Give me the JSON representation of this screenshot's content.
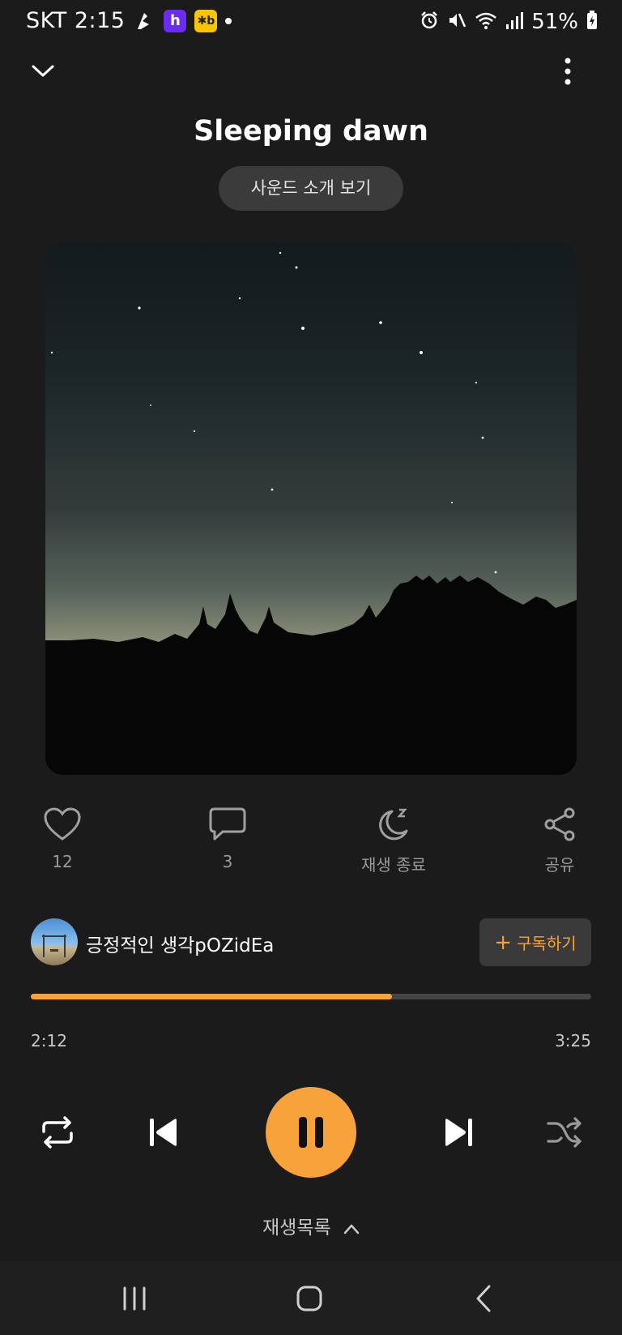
{
  "status_bar": {
    "carrier_time": "SKT 2:15",
    "app2_letter": "h",
    "app3_letter": "✱b",
    "battery": "51%"
  },
  "player": {
    "title": "Sleeping dawn",
    "intro_button": "사운드 소개 보기"
  },
  "actions": {
    "like_count": "12",
    "comment_count": "3",
    "sleep_label": "재생 종료",
    "share_label": "공유"
  },
  "channel": {
    "name": "긍정적인 생각pOZidEa",
    "subscribe_plus": "+",
    "subscribe_label": "구독하기"
  },
  "progress": {
    "elapsed": "2:12",
    "total": "3:25",
    "fraction": 0.644
  },
  "playlist": {
    "label": "재생목록"
  },
  "colors": {
    "accent": "#f7a23a",
    "background": "#1b1b1b"
  }
}
